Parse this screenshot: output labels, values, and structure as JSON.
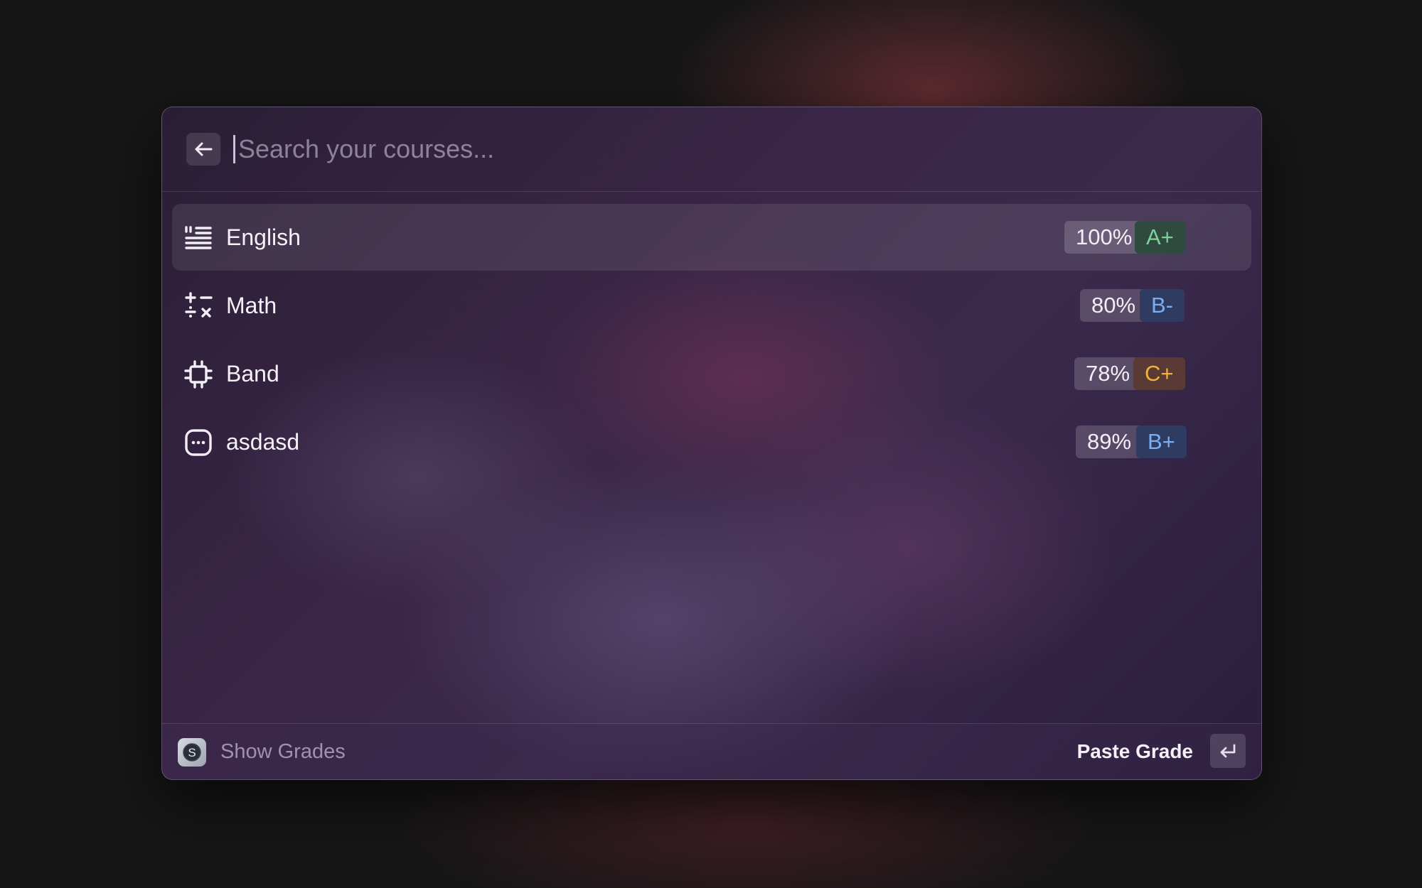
{
  "search": {
    "placeholder": "Search your courses...",
    "value": ""
  },
  "courses": [
    {
      "name": "English",
      "percent": "100%",
      "grade": "A+",
      "icon": "text-align-icon",
      "grade_color": "#7fd19a",
      "grade_bg": "#2f4a3e",
      "selected": true
    },
    {
      "name": "Math",
      "percent": "80%",
      "grade": "B-",
      "icon": "math-operators-icon",
      "grade_color": "#79aef5",
      "grade_bg": "#2f3c62",
      "selected": false
    },
    {
      "name": "Band",
      "percent": "78%",
      "grade": "C+",
      "icon": "chip-icon",
      "grade_color": "#f1b13c",
      "grade_bg": "#5a3a34",
      "selected": false
    },
    {
      "name": "asdasd",
      "percent": "89%",
      "grade": "B+",
      "icon": "chat-bubble-dots-icon",
      "grade_color": "#79aef5",
      "grade_bg": "#2f3c62",
      "selected": false
    }
  ],
  "footer": {
    "app_icon_letter": "S",
    "command_title": "Show Grades",
    "primary_action": "Paste Grade",
    "shortcut_icon": "enter-key-icon"
  }
}
